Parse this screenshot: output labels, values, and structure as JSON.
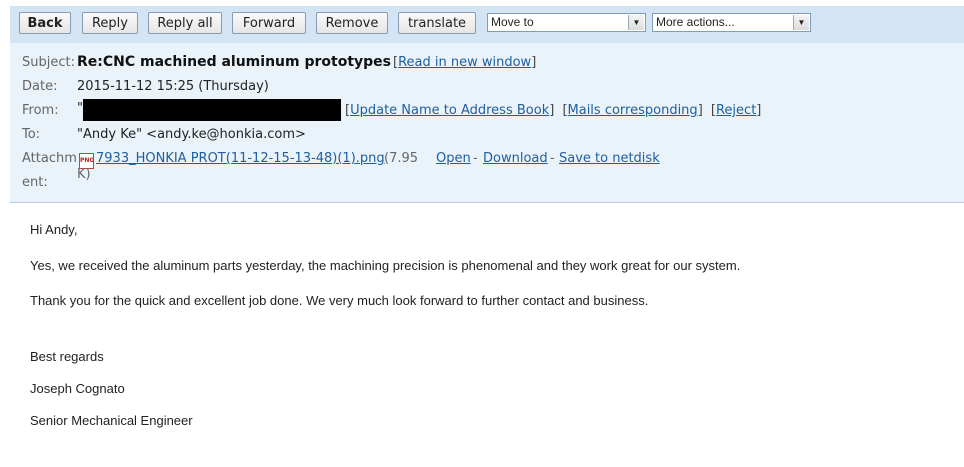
{
  "toolbar": {
    "back": "Back",
    "reply": "Reply",
    "reply_all": "Reply all",
    "forward": "Forward",
    "remove": "Remove",
    "translate": "translate",
    "move_to": "Move to",
    "more_actions": "More actions..."
  },
  "header": {
    "subject_label": "Subject:",
    "subject": "Re:CNC machined aluminum prototypes",
    "read_in_new_window": "Read in new window",
    "date_label": "Date:",
    "date": "2015-11-12 15:25 (Thursday)",
    "from_label": "From:",
    "from_prefix": "\"",
    "update_name": "Update Name to Address Book",
    "mails_corresponding": "Mails corresponding",
    "reject": "Reject",
    "to_label": "To:",
    "to": "\"Andy Ke\" <andy.ke@honkia.com>",
    "attach_label_line1": "Attachm",
    "attach_label_line2": "ent:",
    "attachment_name": "7933_HONKIA PROT(11-12-15-13-48)(1).png",
    "attachment_size_line1": "(7.95",
    "attachment_size_line2": "K)",
    "open": "Open",
    "download": "Download",
    "save_to_netdisk": "Save to netdisk",
    "sep1": "-",
    "sep2": "-",
    "png_icon_text": "PNG"
  },
  "body": {
    "greeting": "Hi Andy,",
    "line1": "Yes, we received the aluminum parts yesterday, the machining precision is phenomenal and they work great for our system.",
    "line2": "Thank you for the quick and excellent job done. We very much look forward to further contact and business.",
    "regards": "Best regards",
    "name": "Joseph Cognato",
    "title": "Senior Mechanical Engineer"
  },
  "colors": {
    "toolbar_bg": "#d3e4f4",
    "header_bg": "#eaf2fa",
    "link": "#1f5fa0"
  }
}
